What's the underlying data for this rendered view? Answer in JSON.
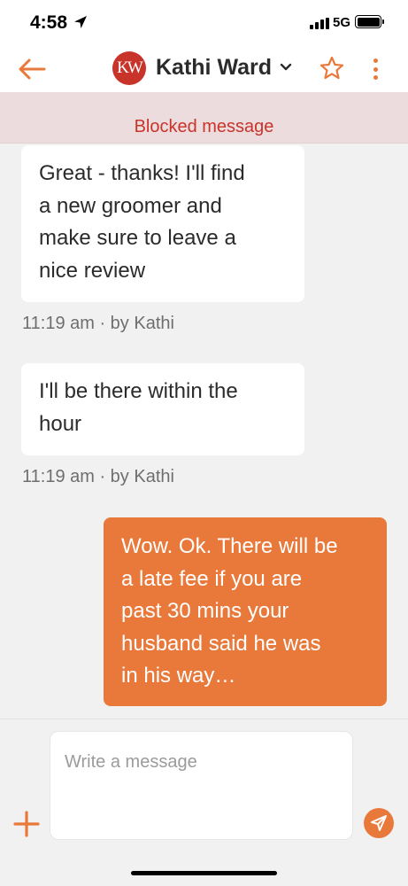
{
  "status_bar": {
    "time": "4:58",
    "network": "5G",
    "icons": [
      "location-arrow-icon",
      "signal-icon",
      "battery-icon"
    ]
  },
  "header": {
    "avatar_initials": "KW",
    "contact_name": "Kathi Ward",
    "icons": [
      "back-arrow-icon",
      "chevron-down-icon",
      "star-icon",
      "more-vertical-icon"
    ],
    "accent_color": "#e8793a",
    "avatar_color": "#c8342a"
  },
  "banner": {
    "text": "Blocked message",
    "text_color": "#c8342a"
  },
  "messages": [
    {
      "direction": "incoming",
      "lines": [
        "Great - thanks!  I'll find",
        "a new groomer and",
        "make sure to leave a",
        "nice review"
      ],
      "meta": "11:19 am · by Kathi"
    },
    {
      "direction": "incoming",
      "lines": [
        "I'll be there within the",
        "hour"
      ],
      "meta": "11:19 am · by Kathi"
    },
    {
      "direction": "outgoing",
      "lines": [
        "Wow. Ok. There will be",
        "a late fee if you are",
        "past 30 mins your",
        "husband said he was",
        "in his way…"
      ]
    }
  ],
  "compose": {
    "placeholder": "Write a message",
    "value": "",
    "icons": [
      "plus-icon",
      "send-icon"
    ]
  }
}
